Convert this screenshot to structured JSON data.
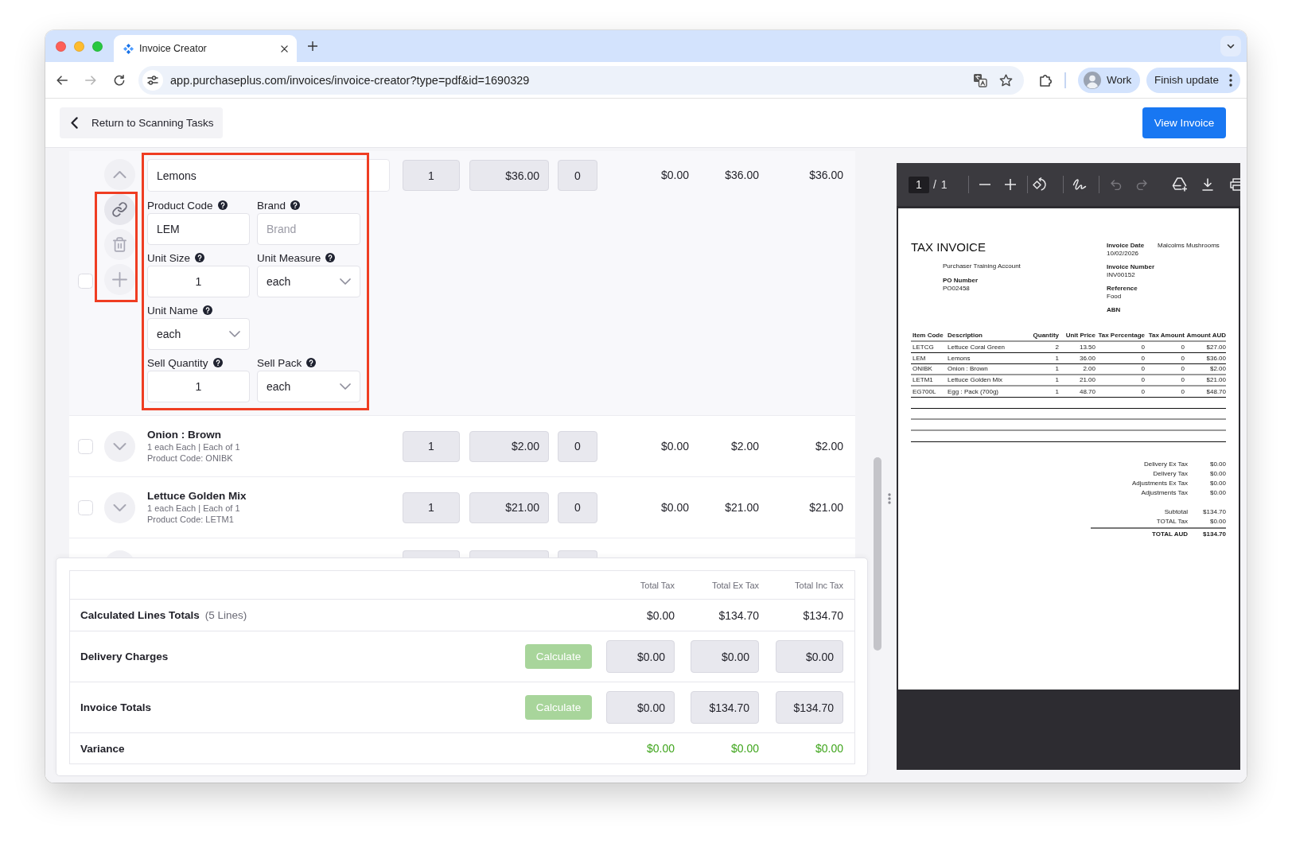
{
  "browser": {
    "tabs": [
      {
        "title": "Invoice Creator",
        "selected": true
      }
    ],
    "back": {
      "disabled": false
    },
    "forward": {
      "disabled": true
    },
    "url": "app.purchaseplus.com/invoices/invoice-creator?type=pdf&id=1690329",
    "profile": "Work",
    "update_button": "Finish update"
  },
  "header": {
    "back_button": "Return to Scanning Tasks",
    "view_button": "View Invoice"
  },
  "lines": [
    {
      "name": "Lemons",
      "expanded": true,
      "checked": false,
      "actions_highlighted": true,
      "details_highlighted": true,
      "quantity": "1",
      "unit_price": "$36.00",
      "tax_percent": "0",
      "total_tax": "$0.00",
      "total_ex_tax": "$36.00",
      "total_inc_tax": "$36.00",
      "detail_rows": [
        {
          "fields": [
            {
              "label": "Product Code",
              "kind": "text",
              "value": "LEM"
            },
            {
              "label": "Brand",
              "kind": "text",
              "placeholder": "Brand"
            }
          ]
        },
        {
          "fields": [
            {
              "label": "Unit Size",
              "kind": "number",
              "value": "1"
            },
            {
              "label": "Unit Measure",
              "kind": "select",
              "value": "each"
            }
          ]
        },
        {
          "fields": [
            {
              "label": "Unit Name",
              "kind": "select",
              "value": "each"
            }
          ]
        },
        {
          "fields": [
            {
              "label": "Sell Quantity",
              "kind": "number",
              "value": "1"
            },
            {
              "label": "Sell Pack",
              "kind": "select",
              "value": "each"
            }
          ]
        }
      ]
    },
    {
      "name": "Onion : Brown",
      "expanded": false,
      "checked": false,
      "pack": "1 each Each | Each of 1",
      "code": "Product Code: ONIBK",
      "quantity": "1",
      "unit_price": "$2.00",
      "tax_percent": "0",
      "total_tax": "$0.00",
      "total_ex_tax": "$2.00",
      "total_inc_tax": "$2.00"
    },
    {
      "name": "Lettuce Golden Mix",
      "expanded": false,
      "checked": false,
      "pack": "1 each Each | Each of 1",
      "code": "Product Code: LETM1",
      "quantity": "1",
      "unit_price": "$21.00",
      "tax_percent": "0",
      "total_tax": "$0.00",
      "total_ex_tax": "$21.00",
      "total_inc_tax": "$21.00"
    }
  ],
  "more_lines_below": true,
  "totals": {
    "columns": [
      "Total Tax",
      "Total Ex Tax",
      "Total Inc Tax"
    ],
    "rows": [
      {
        "kind": "computed",
        "label": "Calculated Lines Totals",
        "note": "(5 Lines)",
        "values": [
          "$0.00",
          "$134.70",
          "$134.70"
        ]
      },
      {
        "kind": "editable",
        "label": "Delivery Charges",
        "button": {
          "label": "Calculate",
          "disabled": true
        },
        "values": [
          "$0.00",
          "$0.00",
          "$0.00"
        ]
      },
      {
        "kind": "editable",
        "label": "Invoice Totals",
        "button": {
          "label": "Calculate",
          "disabled": true
        },
        "values": [
          "$0.00",
          "$134.70",
          "$134.70"
        ]
      },
      {
        "kind": "variance",
        "label": "Variance",
        "values": [
          "$0.00",
          "$0.00",
          "$0.00"
        ]
      }
    ]
  },
  "pdf_viewer": {
    "page": "1",
    "page_count": "/ 1",
    "undo": {
      "disabled": true
    },
    "redo": {
      "disabled": true
    },
    "document": {
      "title": "TAX INVOICE",
      "account": "Purchaser Training Account",
      "po_label": "PO Number",
      "po_number": "PO02458",
      "supplier": "Malcolms Mushrooms",
      "meta": [
        {
          "label": "Invoice Date",
          "value": "10/02/2026"
        },
        {
          "label": "Invoice Number",
          "value": "INV00152"
        },
        {
          "label": "Reference",
          "value": "Food"
        },
        {
          "label": "ABN"
        }
      ],
      "columns": [
        "Item Code",
        "Description",
        "Quantity",
        "Unit Price",
        "Tax Percentage",
        "Tax Amount",
        "Amount AUD"
      ],
      "rows": [
        [
          "LETCG",
          "Lettuce Coral Green",
          "2",
          "13.50",
          "0",
          "0",
          "$27.00"
        ],
        [
          "LEM",
          "Lemons",
          "1",
          "36.00",
          "0",
          "0",
          "$36.00"
        ],
        [
          "ONIBK",
          "Onion : Brown",
          "1",
          "2.00",
          "0",
          "0",
          "$2.00"
        ],
        [
          "LETM1",
          "Lettuce Golden Mix",
          "1",
          "21.00",
          "0",
          "0",
          "$21.00"
        ],
        [
          "EG700L",
          "Egg : Pack (700g)",
          "1",
          "48.70",
          "0",
          "0",
          "$48.70"
        ]
      ],
      "summary": [
        {
          "kind": "line",
          "label": "Delivery Ex Tax",
          "value": "$0.00"
        },
        {
          "kind": "line",
          "label": "Delivery Tax",
          "value": "$0.00"
        },
        {
          "kind": "line",
          "label": "Adjustments Ex Tax",
          "value": "$0.00"
        },
        {
          "kind": "line",
          "label": "Adjustments Tax",
          "value": "$0.00"
        },
        {
          "kind": "subtotal",
          "label": "Subtotal",
          "value": "$134.70"
        },
        {
          "kind": "line",
          "label": "TOTAL Tax",
          "value": "$0.00"
        },
        {
          "kind": "grand",
          "label": "TOTAL AUD",
          "value": "$134.70"
        }
      ]
    }
  }
}
